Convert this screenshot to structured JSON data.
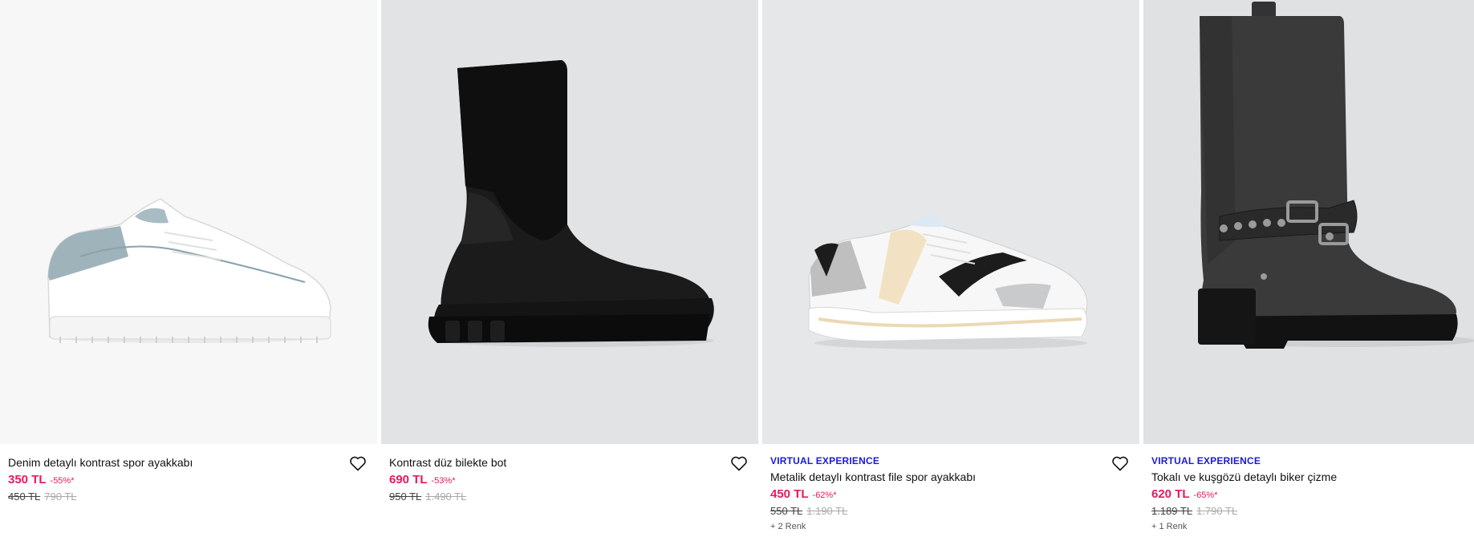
{
  "products": [
    {
      "tag": "",
      "name": "Denim detaylı kontrast spor ayakkabı",
      "price": "350 TL",
      "discount": "-55%*",
      "old_price": "450 TL",
      "original_price": "790 TL",
      "colors": "",
      "image_bg": "#f7f7f7",
      "icon": "heart-outline-icon"
    },
    {
      "tag": "",
      "name": "Kontrast düz bilekte bot",
      "price": "690 TL",
      "discount": "-53%*",
      "old_price": "950 TL",
      "original_price": "1.490 TL",
      "colors": "",
      "image_bg": "#e2e3e5",
      "icon": "heart-outline-icon"
    },
    {
      "tag": "VIRTUAL EXPERIENCE",
      "name": "Metalik detaylı kontrast file spor ayakkabı",
      "price": "450 TL",
      "discount": "-62%*",
      "old_price": "550 TL",
      "original_price": "1.190 TL",
      "colors": "+ 2 Renk",
      "image_bg": "#e6e7e9",
      "icon": "heart-outline-icon"
    },
    {
      "tag": "VIRTUAL EXPERIENCE",
      "name": "Tokalı ve kuşgözü detaylı biker çizme",
      "price": "620 TL",
      "discount": "-65%*",
      "old_price": "1.189 TL",
      "original_price": "1.790 TL",
      "colors": "+ 1 Renk",
      "image_bg": "#e0e1e3",
      "icon": "heart-outline-icon"
    }
  ],
  "colors": {
    "sale": "#e8195e",
    "tag": "#1a1adb"
  }
}
